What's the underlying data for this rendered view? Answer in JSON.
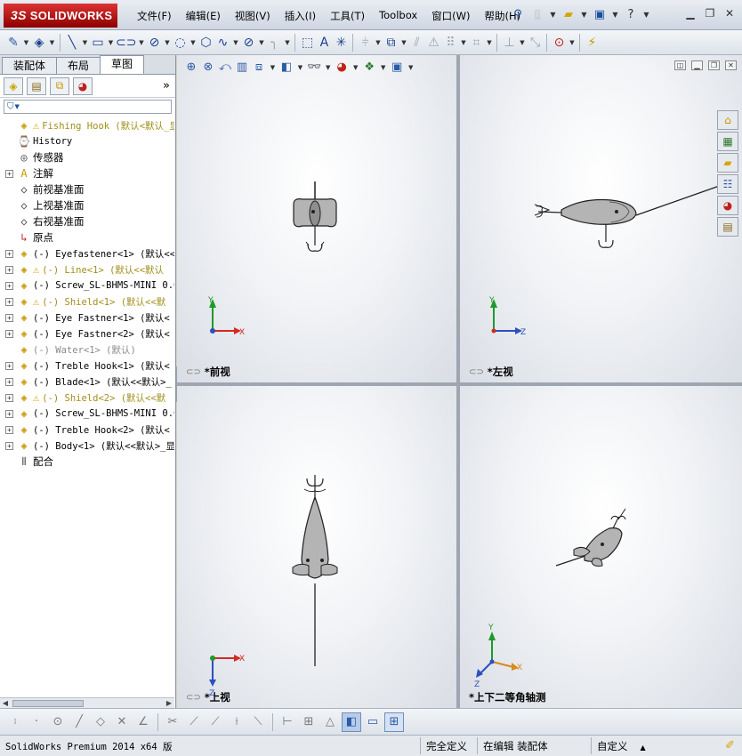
{
  "app": {
    "logo_prefix": "3S",
    "logo_text": "SOLIDWORKS"
  },
  "menus": [
    "文件(F)",
    "编辑(E)",
    "视图(V)",
    "插入(I)",
    "工具(T)",
    "Toolbox",
    "窗口(W)",
    "帮助(H)"
  ],
  "title_tools": {
    "pin_icon": "pushpin-icon",
    "new_icon": "new-document-icon",
    "open_icon": "open-folder-icon",
    "save_icon": "save-icon",
    "help_icon": "help-icon"
  },
  "feature_manager": {
    "tabs": [
      "装配体",
      "布局",
      "草图"
    ],
    "active_tab": "草图",
    "more_glyph": "»",
    "filter_glyph": "▼",
    "tree": [
      {
        "label": "Fishing Hook  (默认<默认_显",
        "icon": "assembly-icon",
        "warn": true,
        "expand": false,
        "style": "yellow",
        "root": true
      },
      {
        "label": "History",
        "icon": "history-icon",
        "warn": false,
        "expand": false,
        "style": "normal"
      },
      {
        "label": "传感器",
        "icon": "sensor-icon",
        "warn": false,
        "expand": false,
        "style": "cjk"
      },
      {
        "label": "注解",
        "icon": "annotation-icon",
        "warn": false,
        "expand": true,
        "style": "cjk"
      },
      {
        "label": "前视基准面",
        "icon": "plane-icon",
        "warn": false,
        "expand": false,
        "style": "cjk"
      },
      {
        "label": "上视基准面",
        "icon": "plane-icon",
        "warn": false,
        "expand": false,
        "style": "cjk"
      },
      {
        "label": "右视基准面",
        "icon": "plane-icon",
        "warn": false,
        "expand": false,
        "style": "cjk"
      },
      {
        "label": "原点",
        "icon": "origin-icon",
        "warn": false,
        "expand": false,
        "style": "cjk"
      },
      {
        "label": "(-) Eyefastener<1> (默认<<",
        "icon": "part-icon",
        "warn": false,
        "expand": true,
        "style": "normal"
      },
      {
        "label": "(-) Line<1> (默认<<默认",
        "icon": "part-icon",
        "warn": true,
        "expand": true,
        "style": "yellow"
      },
      {
        "label": "(-) Screw_SL-BHMS-MINI 0.0",
        "icon": "part-icon",
        "warn": false,
        "expand": true,
        "style": "normal"
      },
      {
        "label": "(-) Shield<1> (默认<<默",
        "icon": "part-icon",
        "warn": true,
        "expand": true,
        "style": "yellow"
      },
      {
        "label": "(-) Eye Fastner<1> (默认<",
        "icon": "part-icon",
        "warn": false,
        "expand": true,
        "style": "normal"
      },
      {
        "label": "(-) Eye Fastner<2> (默认<",
        "icon": "part-icon",
        "warn": false,
        "expand": true,
        "style": "normal"
      },
      {
        "label": "(-) Water<1> (默认)",
        "icon": "part-icon",
        "warn": false,
        "expand": false,
        "style": "grey"
      },
      {
        "label": "(-) Treble Hook<1> (默认<",
        "icon": "part-icon",
        "warn": false,
        "expand": true,
        "style": "normal"
      },
      {
        "label": "(-) Blade<1> (默认<<默认>_",
        "icon": "part-icon",
        "warn": false,
        "expand": true,
        "style": "normal"
      },
      {
        "label": "(-) Shield<2> (默认<<默",
        "icon": "part-icon",
        "warn": true,
        "expand": true,
        "style": "yellow"
      },
      {
        "label": "(-) Screw_SL-BHMS-MINI 0.0",
        "icon": "part-icon",
        "warn": false,
        "expand": true,
        "style": "normal"
      },
      {
        "label": "(-) Treble Hook<2> (默认<",
        "icon": "part-icon",
        "warn": false,
        "expand": true,
        "style": "normal"
      },
      {
        "label": "(-) Body<1> (默认<<默认>_显",
        "icon": "part-icon",
        "warn": false,
        "expand": true,
        "style": "normal"
      },
      {
        "label": "配合",
        "icon": "mates-icon",
        "warn": false,
        "expand": false,
        "style": "cjk"
      }
    ]
  },
  "viewports": {
    "front": {
      "label": "*前视",
      "axes": [
        "Y",
        "X"
      ]
    },
    "left": {
      "label": "*左视",
      "axes": [
        "Y",
        "Z"
      ]
    },
    "top": {
      "label": "*上视",
      "axes": [
        "X",
        "Z"
      ]
    },
    "iso": {
      "label": "*上下二等角轴测",
      "axes": [
        "Y",
        "X",
        "Z"
      ]
    }
  },
  "colors": {
    "axis_x": "#d42a1e",
    "axis_y": "#1f9a2a",
    "axis_z": "#2d4fc0",
    "axis_iso_x": "#d98a1a",
    "model_body": "#b4b4b4",
    "model_outline": "#222222"
  },
  "statusbar": {
    "app_version": "SolidWorks Premium 2014 x64 版",
    "defined": "完全定义",
    "editing": "在编辑 装配体",
    "units": "自定义",
    "units_caret": "▲"
  }
}
